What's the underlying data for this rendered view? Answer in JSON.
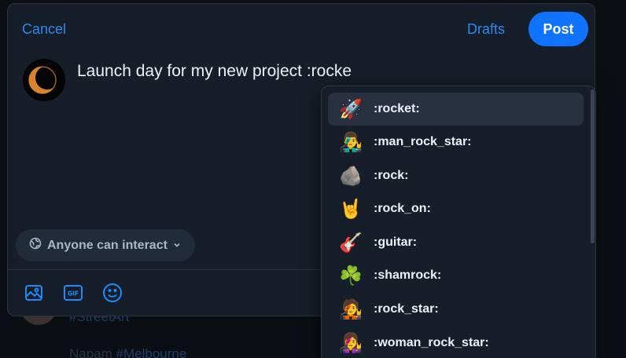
{
  "background": {
    "line1": "#StreetArt",
    "line2_name": "Napam",
    "line2_tag": "#Melbourne"
  },
  "composer": {
    "cancel_label": "Cancel",
    "drafts_label": "Drafts",
    "post_label": "Post",
    "text": "Launch day for my new project :rocke",
    "interact_label": "Anyone can interact",
    "tools": [
      "image-icon",
      "gif-icon",
      "emoji-icon"
    ],
    "gif_label": "GIF"
  },
  "suggestions": [
    {
      "emoji": "🚀",
      "code": ":rocket:",
      "active": true
    },
    {
      "emoji": "👨‍🎤",
      "code": ":man_rock_star:"
    },
    {
      "emoji": "🪨",
      "code": ":rock:"
    },
    {
      "emoji": "🤘",
      "code": ":rock_on:"
    },
    {
      "emoji": "🎸",
      "code": ":guitar:"
    },
    {
      "emoji": "☘️",
      "code": ":shamrock:"
    },
    {
      "emoji": "🧑‍🎤",
      "code": ":rock_star:"
    },
    {
      "emoji": "👩‍🎤",
      "code": ":woman_rock_star:"
    }
  ],
  "colors": {
    "accent": "#0f73ff",
    "link": "#2d89ef",
    "surface": "#161e29",
    "highlight": "#27313f"
  }
}
